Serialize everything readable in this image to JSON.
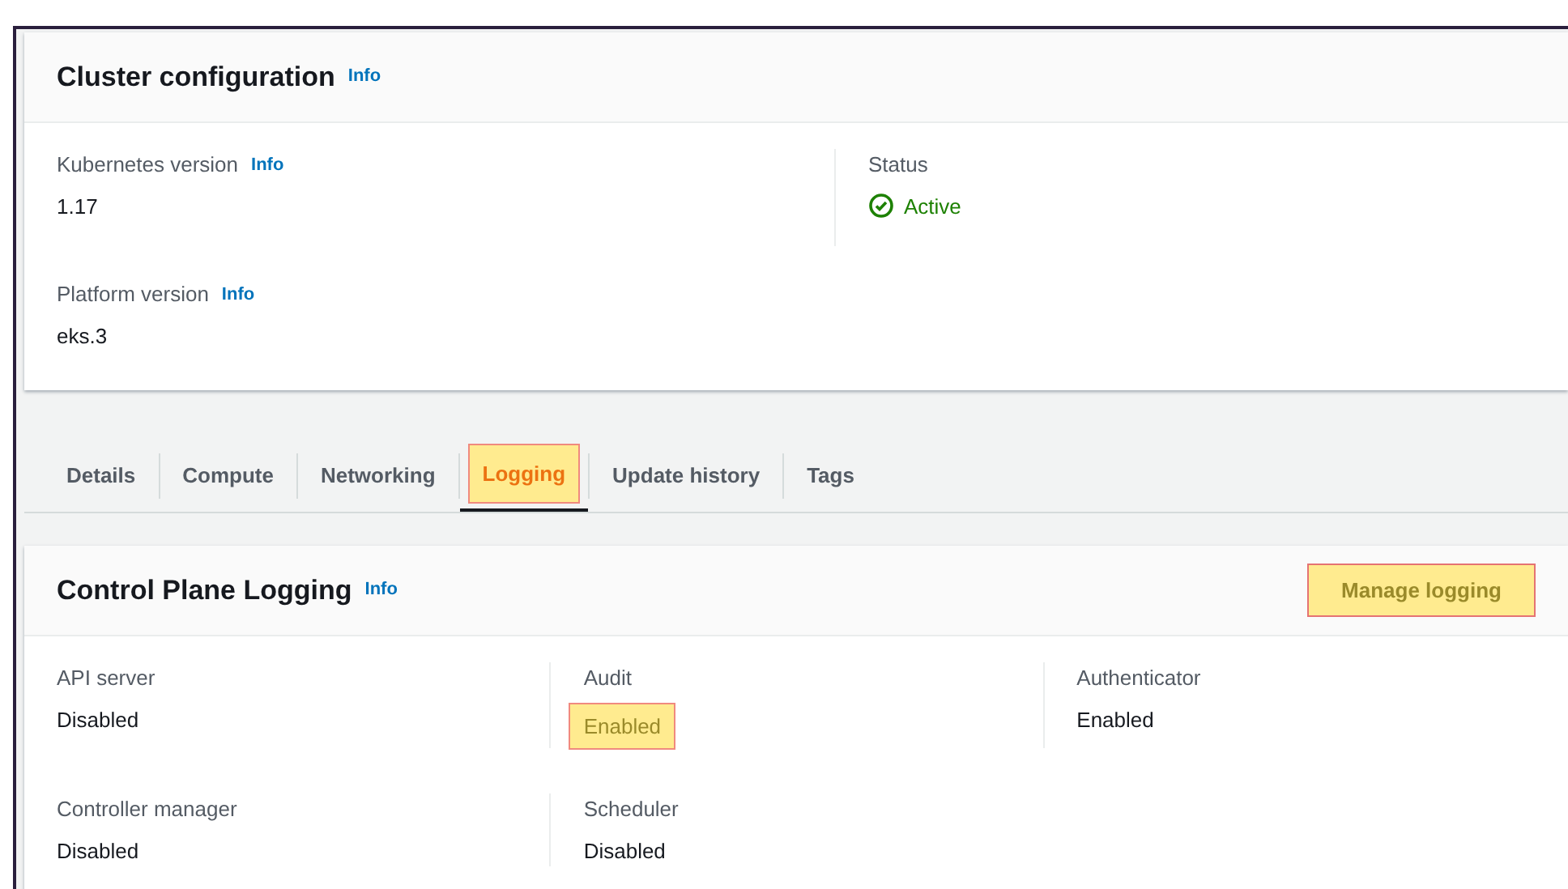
{
  "cluster_configuration": {
    "title": "Cluster configuration",
    "info": "Info",
    "fields": [
      {
        "label": "Kubernetes version",
        "info": "Info",
        "value": "1.17",
        "kind": "text"
      },
      {
        "label": "Status",
        "value": "Active",
        "kind": "status"
      },
      {
        "label": "Platform version",
        "info": "Info",
        "value": "eks.3",
        "kind": "text"
      }
    ]
  },
  "tabs": [
    {
      "label": "Details",
      "selected": false,
      "highlighted": false
    },
    {
      "label": "Compute",
      "selected": false,
      "highlighted": false
    },
    {
      "label": "Networking",
      "selected": false,
      "highlighted": false
    },
    {
      "label": "Logging",
      "selected": true,
      "highlighted": true
    },
    {
      "label": "Update history",
      "selected": false,
      "highlighted": false
    },
    {
      "label": "Tags",
      "selected": false,
      "highlighted": false
    }
  ],
  "control_plane_logging": {
    "title": "Control Plane Logging",
    "info": "Info",
    "button": {
      "label": "Manage logging",
      "highlighted": true
    },
    "fields": [
      {
        "label": "API server",
        "value": "Disabled",
        "highlighted": false
      },
      {
        "label": "Audit",
        "value": "Enabled",
        "highlighted": true
      },
      {
        "label": "Authenticator",
        "value": "Enabled",
        "highlighted": false
      },
      {
        "label": "Controller manager",
        "value": "Disabled",
        "highlighted": false
      },
      {
        "label": "Scheduler",
        "value": "Disabled",
        "highlighted": false
      }
    ]
  }
}
